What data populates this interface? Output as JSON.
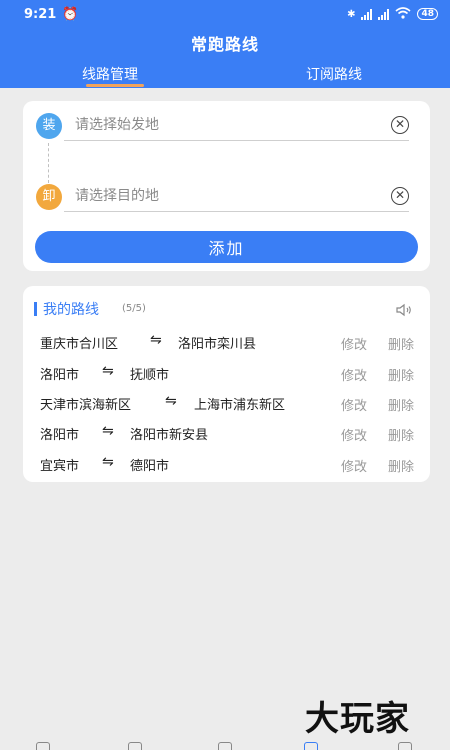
{
  "status_bar": {
    "time": "9:21",
    "battery": "48"
  },
  "header": {
    "title": "常跑路线",
    "tabs": [
      {
        "label": "线路管理",
        "active": true
      },
      {
        "label": "订阅路线",
        "active": false
      }
    ]
  },
  "form": {
    "load_badge": "装",
    "unload_badge": "卸",
    "origin_placeholder": "请选择始发地",
    "destination_placeholder": "请选择目的地",
    "add_label": "添加"
  },
  "routes_section": {
    "title": "我的路线",
    "count": "(5/5)",
    "arrow": "⇋",
    "edit_label": "修改",
    "delete_label": "删除",
    "routes": [
      {
        "from": "重庆市合川区",
        "to": "洛阳市栾川县"
      },
      {
        "from": "洛阳市",
        "to": "抚顺市"
      },
      {
        "from": "天津市滨海新区",
        "to": "上海市浦东新区"
      },
      {
        "from": "洛阳市",
        "to": "洛阳市新安县"
      },
      {
        "from": "宜宾市",
        "to": "德阳市"
      }
    ]
  },
  "watermark": "大玩家",
  "colors": {
    "primary": "#3a7ef5",
    "accent_orange": "#f2a35a",
    "load_badge": "#4fa6ee",
    "unload_badge": "#f2a83d",
    "background": "#ececec"
  }
}
